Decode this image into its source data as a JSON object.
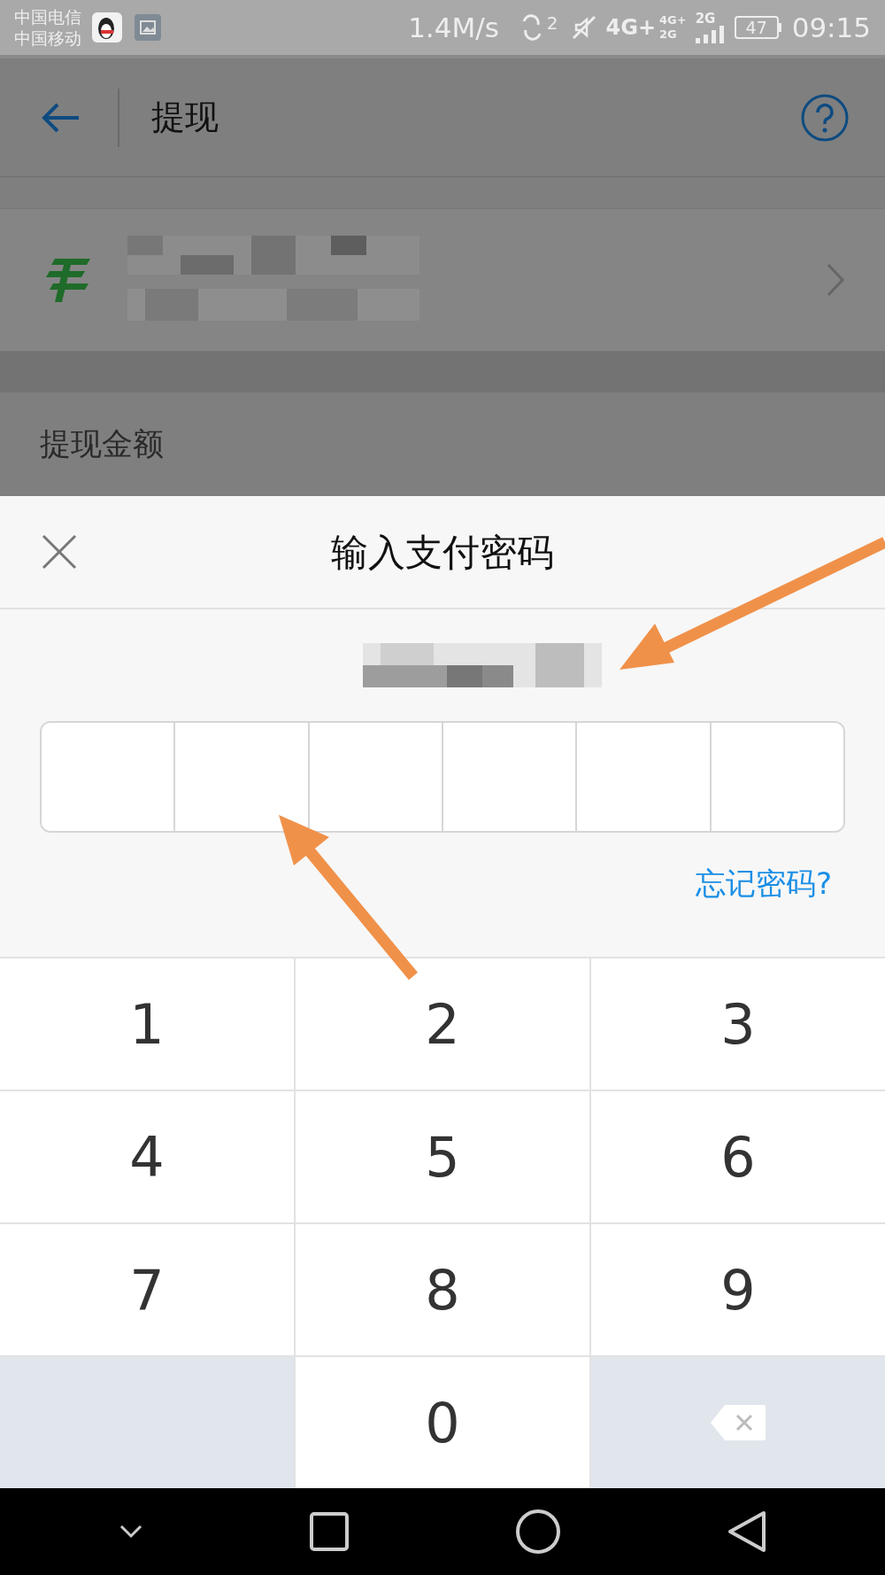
{
  "status_bar": {
    "carriers": [
      "中国电信",
      "中国移动"
    ],
    "speed": "1.4M/s",
    "sim_badge": "2",
    "network_top": "4G+",
    "network_mini_top": "4G+",
    "network_mini_bottom": "2G",
    "network_second": "2G",
    "battery": "47",
    "time": "09:15"
  },
  "header": {
    "title": "提现"
  },
  "section_label": "提现金额",
  "dialog": {
    "title": "输入支付密码",
    "pin_boxes": [
      {
        "filled": false
      },
      {
        "filled": false
      },
      {
        "filled": false
      },
      {
        "filled": false
      },
      {
        "filled": false
      },
      {
        "filled": false
      }
    ],
    "forgot_link": "忘记密码?"
  },
  "keypad": [
    {
      "kind": "digit",
      "label": "1"
    },
    {
      "kind": "digit",
      "label": "2"
    },
    {
      "kind": "digit",
      "label": "3"
    },
    {
      "kind": "digit",
      "label": "4"
    },
    {
      "kind": "digit",
      "label": "5"
    },
    {
      "kind": "digit",
      "label": "6"
    },
    {
      "kind": "digit",
      "label": "7"
    },
    {
      "kind": "digit",
      "label": "8"
    },
    {
      "kind": "digit",
      "label": "9"
    },
    {
      "kind": "blank"
    },
    {
      "kind": "digit",
      "label": "0"
    },
    {
      "kind": "backspace"
    }
  ]
}
